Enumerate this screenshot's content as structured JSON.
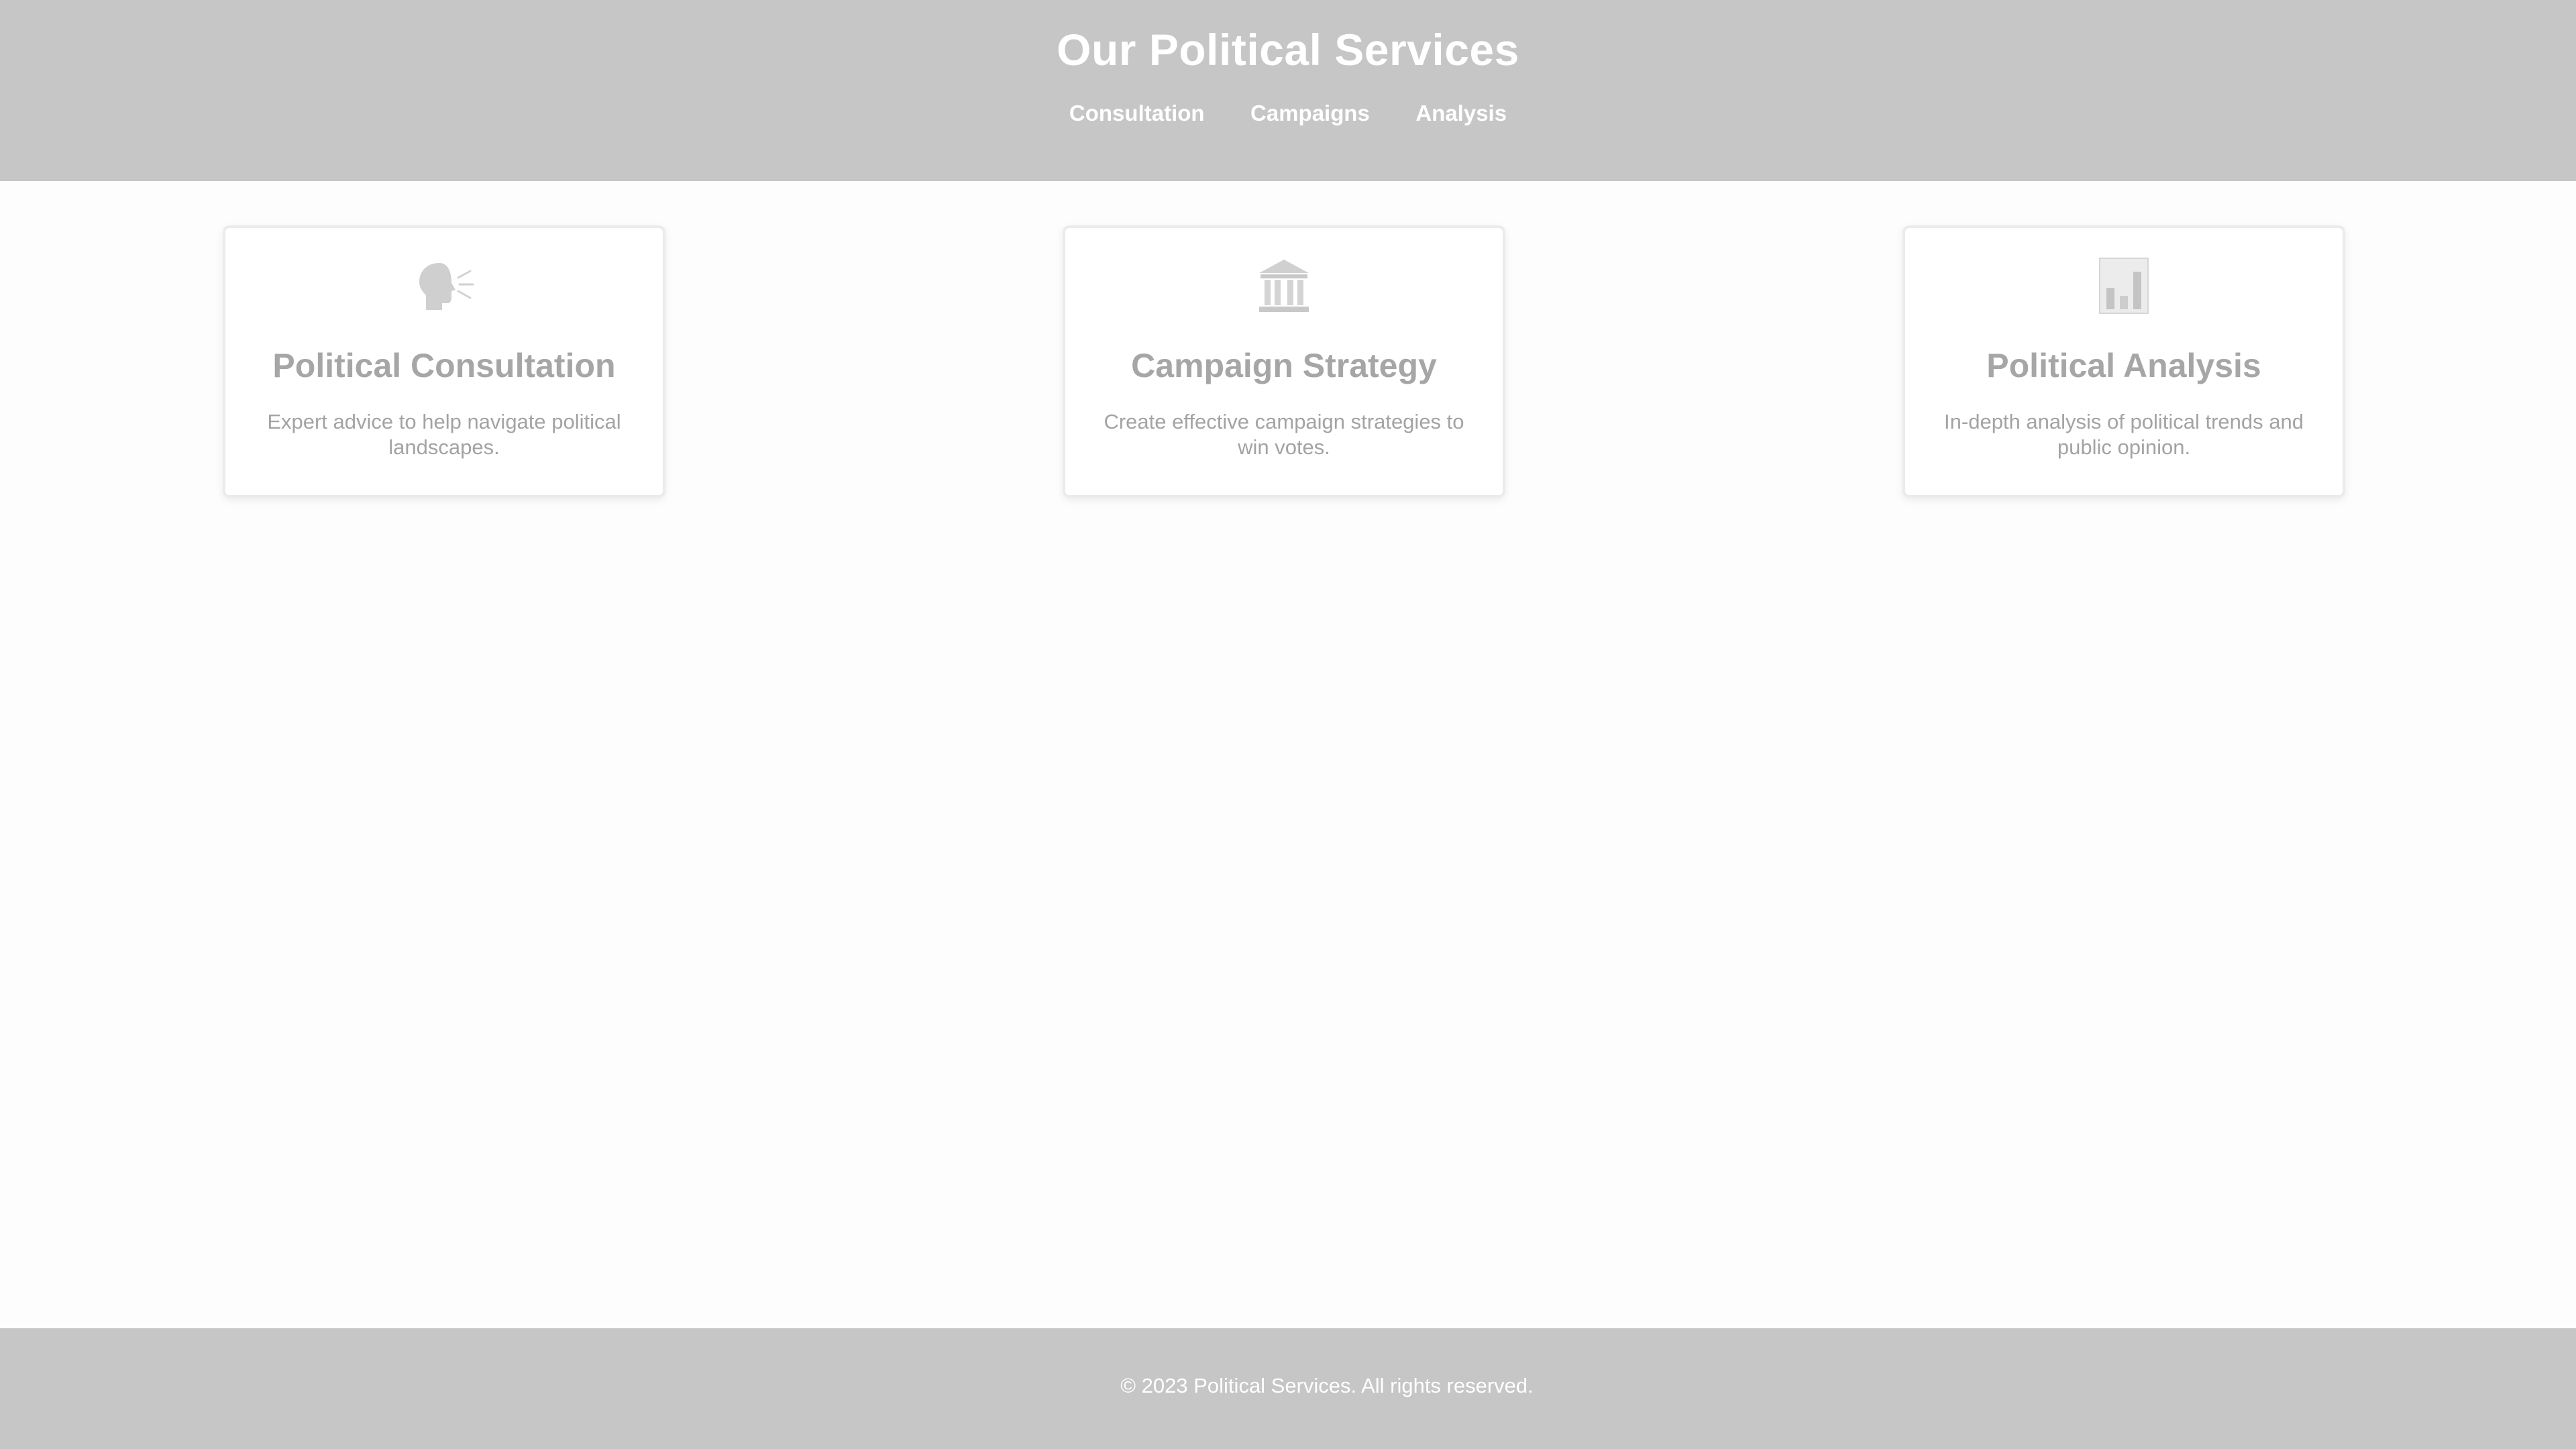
{
  "header": {
    "title": "Our Political Services",
    "nav": [
      {
        "label": "Consultation"
      },
      {
        "label": "Campaigns"
      },
      {
        "label": "Analysis"
      }
    ]
  },
  "services": [
    {
      "icon": "speaking-head-icon",
      "title": "Political Consultation",
      "description": "Expert advice to help navigate political landscapes."
    },
    {
      "icon": "classical-building-icon",
      "title": "Campaign Strategy",
      "description": "Create effective campaign strategies to win votes."
    },
    {
      "icon": "bar-chart-icon",
      "title": "Political Analysis",
      "description": "In-depth analysis of political trends and public opinion."
    }
  ],
  "footer": {
    "copyright": "© 2023 Political Services. All rights reserved."
  },
  "colors": {
    "header_bg": "#c6c6c6",
    "footer_bg": "#c6c6c6",
    "card_text": "#a6a6a6",
    "page_bg": "#fdfdfd"
  }
}
